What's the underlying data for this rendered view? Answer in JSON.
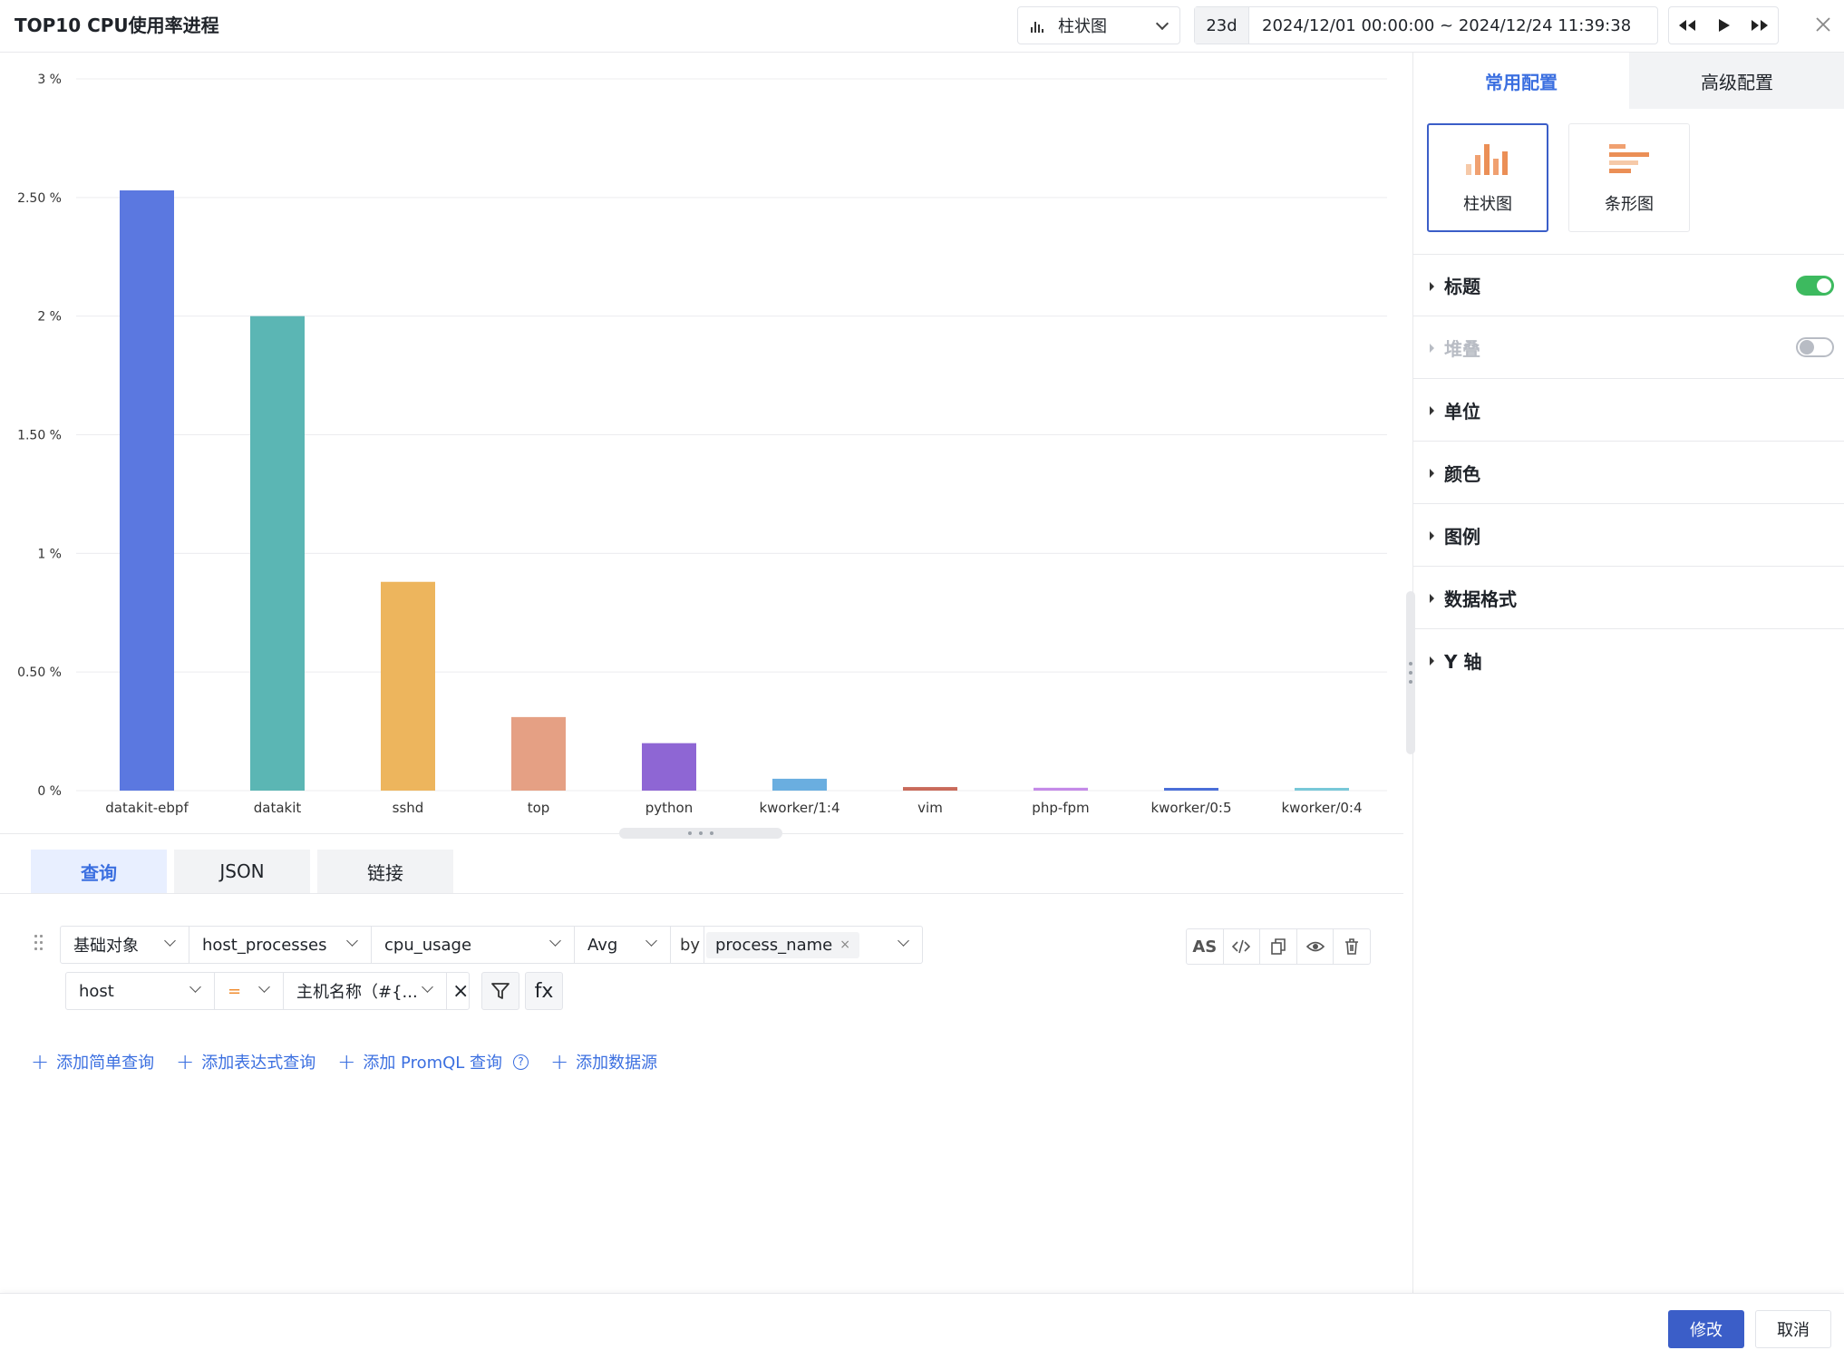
{
  "header": {
    "title": "TOP10 CPU使用率进程",
    "chart_type_label": "柱状图",
    "time_range_short": "23d",
    "time_range_value": "2024/12/01 00:00:00 ~ 2024/12/24 11:39:38"
  },
  "chart_data": {
    "type": "bar",
    "categories": [
      "datakit-ebpf",
      "datakit",
      "sshd",
      "top",
      "python",
      "kworker/1:4",
      "vim",
      "php-fpm",
      "kworker/0:5",
      "kworker/0:4"
    ],
    "values": [
      2.53,
      2.0,
      0.88,
      0.31,
      0.2,
      0.05,
      0.015,
      0.012,
      0.008,
      0.006
    ],
    "colors": [
      "#5b78e0",
      "#5bb6b4",
      "#edb55d",
      "#e5a084",
      "#8e66d4",
      "#6aaee0",
      "#c96a5a",
      "#c48ae8",
      "#4a6fd8",
      "#78c8d8"
    ],
    "ylim": [
      0,
      3
    ],
    "yticks": [
      0,
      0.5,
      1,
      1.5,
      2,
      2.5,
      3
    ],
    "ytick_labels": [
      "0 %",
      "0.50 %",
      "1 %",
      "1.50 %",
      "2 %",
      "2.50 %",
      "3 %"
    ],
    "grid": true
  },
  "query_tabs": [
    "查询",
    "JSON",
    "链接"
  ],
  "query": {
    "object_type": "基础对象",
    "measurement": "host_processes",
    "field": "cpu_usage",
    "aggregation": "Avg",
    "by_label": "by",
    "group_by": "process_name",
    "filter_key": "host",
    "filter_op": "=",
    "filter_value": "主机名称（#{...",
    "as_label": "AS",
    "fx_label": "fx",
    "remove_filter": "×",
    "chip_remove": "×"
  },
  "add_links": {
    "simple": "添加简单查询",
    "expression": "添加表达式查询",
    "promql": "添加 PromQL 查询",
    "datasource": "添加数据源",
    "help": "?"
  },
  "footer": {
    "confirm": "修改",
    "cancel": "取消"
  },
  "panel": {
    "tabs": [
      "常用配置",
      "高级配置"
    ],
    "chart_types": [
      "柱状图",
      "条形图"
    ],
    "sections": [
      "标题",
      "堆叠",
      "单位",
      "颜色",
      "图例",
      "数据格式",
      "Y 轴"
    ],
    "title_toggle": true,
    "stack_toggle": false
  },
  "colors": {
    "accent": "#3b6fe0",
    "primary_button": "#3b5ec8",
    "toggle_on": "#3dba5f"
  }
}
